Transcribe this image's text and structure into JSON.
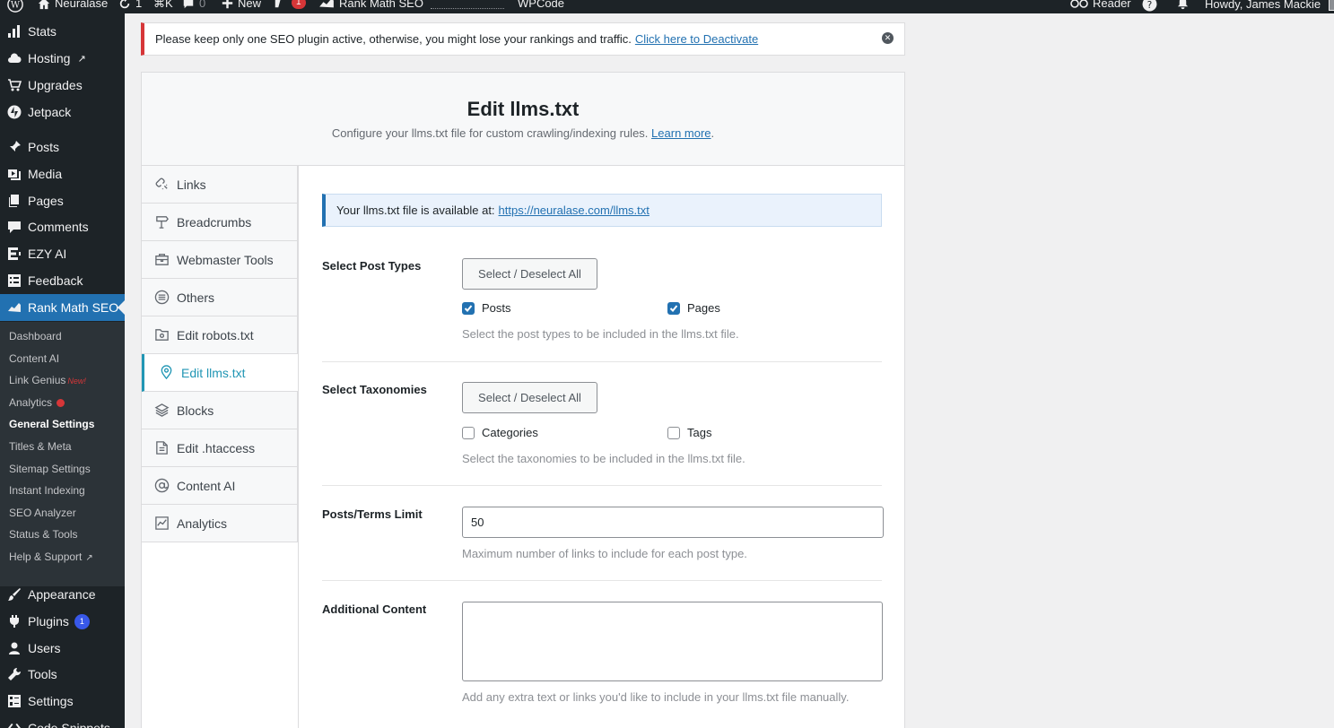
{
  "admin_bar": {
    "site_name": "Neuralase",
    "updates_count": "1",
    "shortcut": "⌘K",
    "comments_count": "0",
    "new_label": "New",
    "yoast_badge": "1",
    "rank_math_label": "Rank Math SEO",
    "wpcode_label": "WPCode",
    "reader_label": "Reader",
    "greeting": "Howdy, James Mackie"
  },
  "sidebar": {
    "items": [
      {
        "label": "Stats",
        "icon": "stats-icon"
      },
      {
        "label": "Hosting",
        "icon": "cloud-icon"
      },
      {
        "label": "Upgrades",
        "icon": "cart-icon"
      },
      {
        "label": "Jetpack",
        "icon": "jetpack-icon"
      },
      {
        "label": "Posts",
        "icon": "pin-icon"
      },
      {
        "label": "Media",
        "icon": "media-icon"
      },
      {
        "label": "Pages",
        "icon": "pages-icon"
      },
      {
        "label": "Comments",
        "icon": "comment-icon"
      },
      {
        "label": "EZY AI",
        "icon": "ezy-icon"
      },
      {
        "label": "Feedback",
        "icon": "feedback-icon"
      },
      {
        "label": "Rank Math SEO",
        "icon": "rankmath-icon"
      },
      {
        "label": "Appearance",
        "icon": "brush-icon"
      },
      {
        "label": "Plugins",
        "icon": "plugin-icon",
        "badge": "1"
      },
      {
        "label": "Users",
        "icon": "user-icon"
      },
      {
        "label": "Tools",
        "icon": "wrench-icon"
      },
      {
        "label": "Settings",
        "icon": "settings-icon"
      },
      {
        "label": "Code Snippets",
        "icon": "code-icon"
      }
    ],
    "submenu": [
      {
        "label": "Dashboard"
      },
      {
        "label": "Content AI"
      },
      {
        "label": "Link Genius",
        "tag": "New!"
      },
      {
        "label": "Analytics"
      },
      {
        "label": "General Settings"
      },
      {
        "label": "Titles & Meta"
      },
      {
        "label": "Sitemap Settings"
      },
      {
        "label": "Instant Indexing"
      },
      {
        "label": "SEO Analyzer"
      },
      {
        "label": "Status & Tools"
      },
      {
        "label": "Help & Support"
      }
    ]
  },
  "notice": {
    "text": "Please keep only one SEO plugin active, otherwise, you might lose your rankings and traffic.",
    "link": "Click here to Deactivate"
  },
  "header": {
    "title": "Edit llms.txt",
    "subtitle": "Configure your llms.txt file for custom crawling/indexing rules.",
    "learn_more": "Learn more",
    "period": "."
  },
  "tabs": [
    {
      "label": "Links",
      "icon": "links-icon"
    },
    {
      "label": "Breadcrumbs",
      "icon": "signpost-icon"
    },
    {
      "label": "Webmaster Tools",
      "icon": "briefcase-icon"
    },
    {
      "label": "Others",
      "icon": "list-circle-icon"
    },
    {
      "label": "Edit robots.txt",
      "icon": "robots-folder-icon"
    },
    {
      "label": "Edit llms.txt",
      "icon": "llms-pin-icon"
    },
    {
      "label": "Blocks",
      "icon": "blocks-icon"
    },
    {
      "label": "Edit .htaccess",
      "icon": "file-icon"
    },
    {
      "label": "Content AI",
      "icon": "at-icon"
    },
    {
      "label": "Analytics",
      "icon": "chart-line-icon"
    }
  ],
  "availability": {
    "text": "Your llms.txt file is available at:",
    "url": "https://neuralase.com/llms.txt"
  },
  "post_types": {
    "label": "Select Post Types",
    "toggle_all": "Select / Deselect All",
    "options": [
      {
        "label": "Posts",
        "checked": true
      },
      {
        "label": "Pages",
        "checked": true
      }
    ],
    "description": "Select the post types to be included in the llms.txt file."
  },
  "taxonomies": {
    "label": "Select Taxonomies",
    "toggle_all": "Select / Deselect All",
    "options": [
      {
        "label": "Categories",
        "checked": false
      },
      {
        "label": "Tags",
        "checked": false
      }
    ],
    "description": "Select the taxonomies to be included in the llms.txt file."
  },
  "limit": {
    "label": "Posts/Terms Limit",
    "value": "50",
    "description": "Maximum number of links to include for each post type."
  },
  "additional": {
    "label": "Additional Content",
    "value": "",
    "description": "Add any extra text or links you'd like to include in your llms.txt file manually."
  },
  "colors": {
    "accent": "#2196b4",
    "admin_blue": "#2271b1",
    "notice_red": "#d63638"
  }
}
